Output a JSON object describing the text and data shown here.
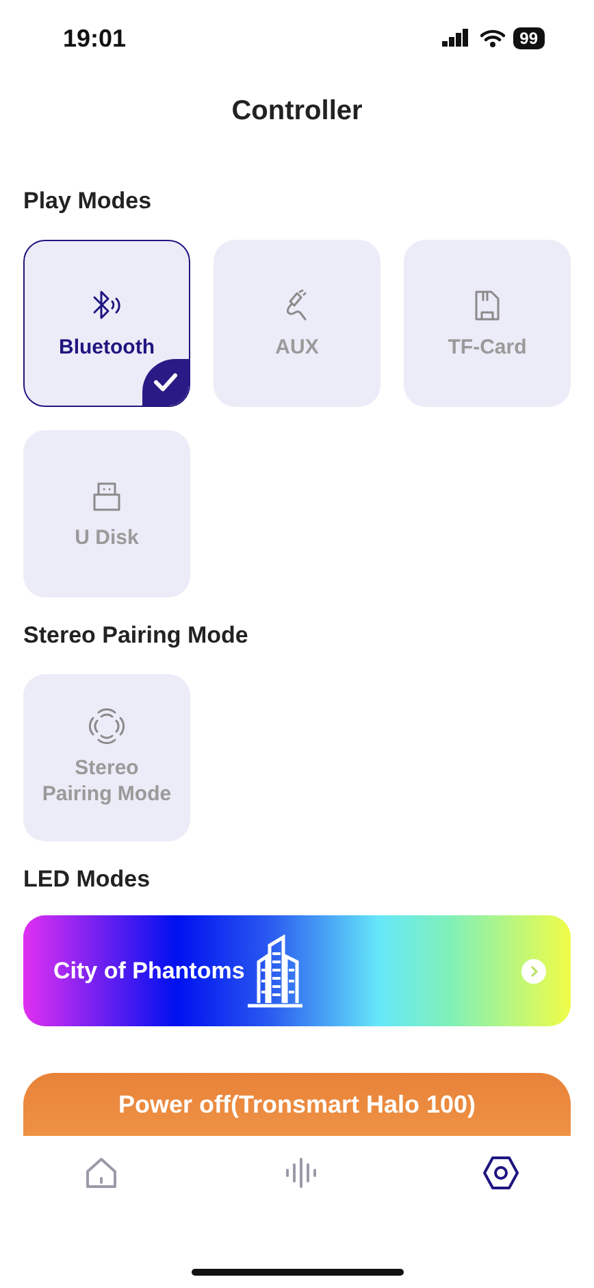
{
  "status_bar": {
    "time": "19:01",
    "battery": "99"
  },
  "title": "Controller",
  "play_modes": {
    "heading": "Play Modes",
    "items": [
      {
        "label": "Bluetooth",
        "kind": "bluetooth",
        "selected": true
      },
      {
        "label": "AUX",
        "kind": "aux",
        "selected": false
      },
      {
        "label": "TF-Card",
        "kind": "card",
        "selected": false
      },
      {
        "label": "U Disk",
        "kind": "usb",
        "selected": false
      }
    ]
  },
  "stereo_pairing": {
    "heading": "Stereo Pairing Mode",
    "items": [
      {
        "label": "Stereo Pairing Mode",
        "kind": "stereo",
        "selected": false
      }
    ]
  },
  "led_modes": {
    "heading": "LED Modes",
    "current": "City of Phantoms"
  },
  "power_button": "Power off(Tronsmart Halo 100)",
  "tab_bar": [
    {
      "kind": "home",
      "selected": false
    },
    {
      "kind": "sound",
      "selected": false
    },
    {
      "kind": "settings",
      "selected": true
    }
  ]
}
